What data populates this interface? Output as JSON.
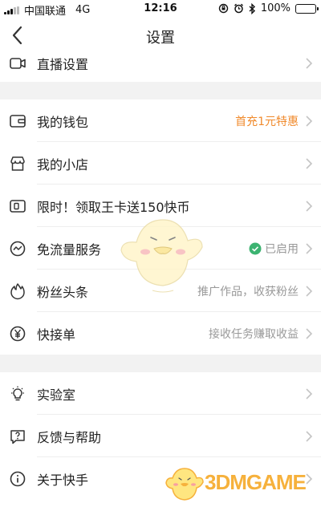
{
  "status_bar": {
    "carrier": "中国联通",
    "network": "4G",
    "time": "12:16",
    "battery": "100%",
    "battery_level": 1.0
  },
  "nav": {
    "title": "设置"
  },
  "section1": [
    {
      "label": "直播设置",
      "icon": "video-camera-icon"
    }
  ],
  "section2": [
    {
      "label": "我的钱包",
      "icon": "wallet-icon",
      "extra": "首充1元特惠",
      "extra_color": "#f08a2c"
    },
    {
      "label": "我的小店",
      "icon": "shop-icon"
    },
    {
      "label": "限时！领取王卡送150快币",
      "icon": "sim-card-icon"
    },
    {
      "label": "免流量服务",
      "icon": "data-flow-icon",
      "extra": "已启用",
      "extra_icon": "check-circle-icon",
      "extra_icon_color": "#3cb371"
    },
    {
      "label": "粉丝头条",
      "icon": "flame-icon",
      "extra": "推广作品，收获粉丝"
    },
    {
      "label": "快接单",
      "icon": "yen-coin-icon",
      "extra": "接收任务赚取收益"
    }
  ],
  "section3": [
    {
      "label": "实验室",
      "icon": "lightbulb-icon"
    },
    {
      "label": "反馈与帮助",
      "icon": "question-bubble-icon"
    },
    {
      "label": "关于快手",
      "icon": "info-icon"
    }
  ],
  "watermark": {
    "text": "3DMGAME"
  },
  "colors": {
    "accent": "#f08a2c",
    "section_gap": "#f2f2f2",
    "secondary_text": "#999999"
  }
}
